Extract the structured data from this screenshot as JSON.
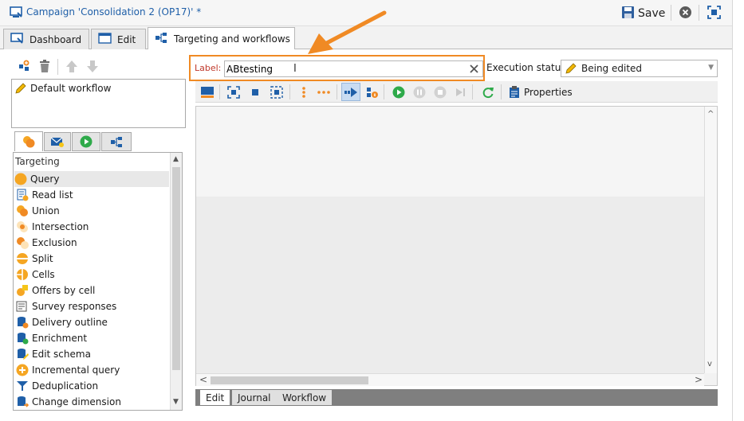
{
  "window": {
    "title": "Campaign 'Consolidation 2 (OP17)' *",
    "save_label": "Save"
  },
  "tabs": [
    {
      "label": "Dashboard"
    },
    {
      "label": "Edit"
    },
    {
      "label": "Targeting and workflows"
    }
  ],
  "workflow_list": {
    "items": [
      "Default workflow"
    ]
  },
  "palette": {
    "section_title": "Targeting",
    "items": [
      "Query",
      "Read list",
      "Union",
      "Intersection",
      "Exclusion",
      "Split",
      "Cells",
      "Offers by cell",
      "Survey responses",
      "Delivery outline",
      "Enrichment",
      "Edit schema",
      "Incremental query",
      "Deduplication",
      "Change dimension"
    ]
  },
  "form": {
    "label_caption": "Label:",
    "label_value": "ABtesting",
    "execution_status_label": "Execution status:",
    "execution_status_value": "Being edited"
  },
  "toolbar": {
    "properties_label": "Properties"
  },
  "bottom_tabs": [
    "Edit",
    "Journal",
    "Workflow"
  ],
  "colors": {
    "accent_orange": "#f08a24",
    "label_red": "#c0392b",
    "title_blue": "#1f5fa8",
    "go_green": "#2eaa4a"
  }
}
